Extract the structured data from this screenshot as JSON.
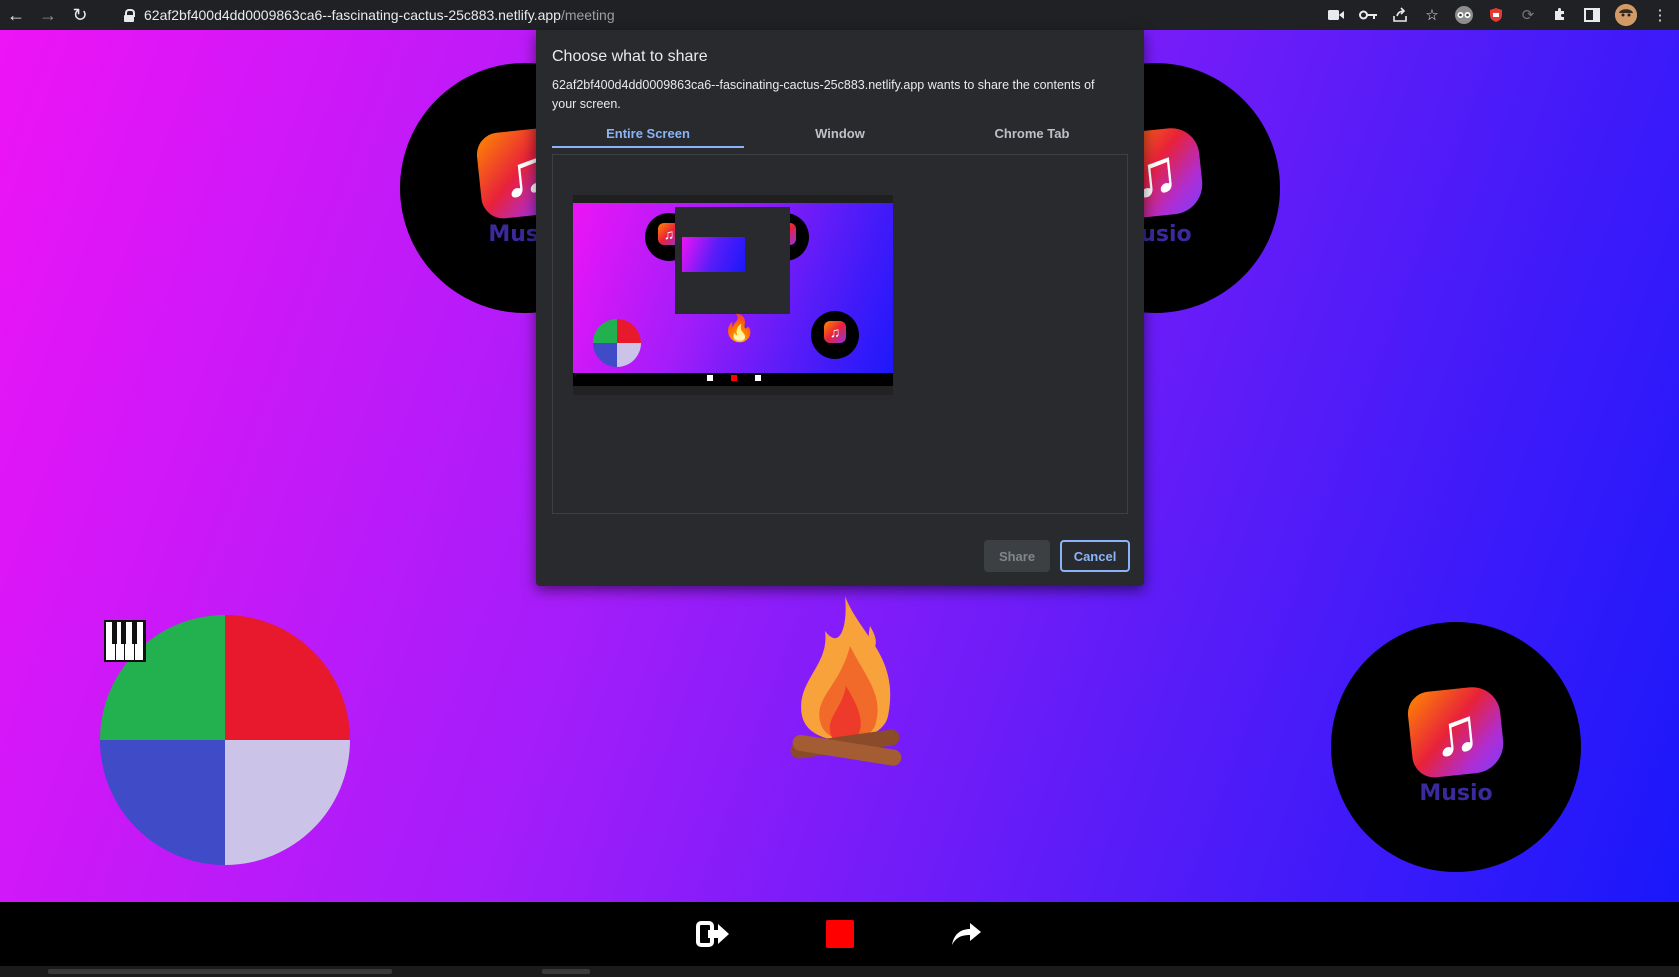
{
  "browser": {
    "url_host": "62af2bf400d4dd0009863ca6--fascinating-cactus-25c883.netlify.app",
    "url_path": "/meeting"
  },
  "page": {
    "brand_name": "Musio"
  },
  "dialog": {
    "title": "Choose what to share",
    "description": "62af2bf400d4dd0009863ca6--fascinating-cactus-25c883.netlify.app wants to share the contents of your screen.",
    "tabs": [
      {
        "label": "Entire Screen",
        "active": true
      },
      {
        "label": "Window",
        "active": false
      },
      {
        "label": "Chrome Tab",
        "active": false
      }
    ],
    "share_label": "Share",
    "cancel_label": "Cancel"
  },
  "colors": {
    "accent": "#8ab4f8",
    "stop_button": "#ff0000",
    "pie_red": "#e8192c",
    "pie_lavender": "#cbc3e8",
    "pie_blue": "#3f4bc7",
    "pie_green": "#23b04e"
  },
  "controls": {
    "icons": [
      "leave-icon",
      "stop-icon",
      "share-forward-icon"
    ]
  }
}
